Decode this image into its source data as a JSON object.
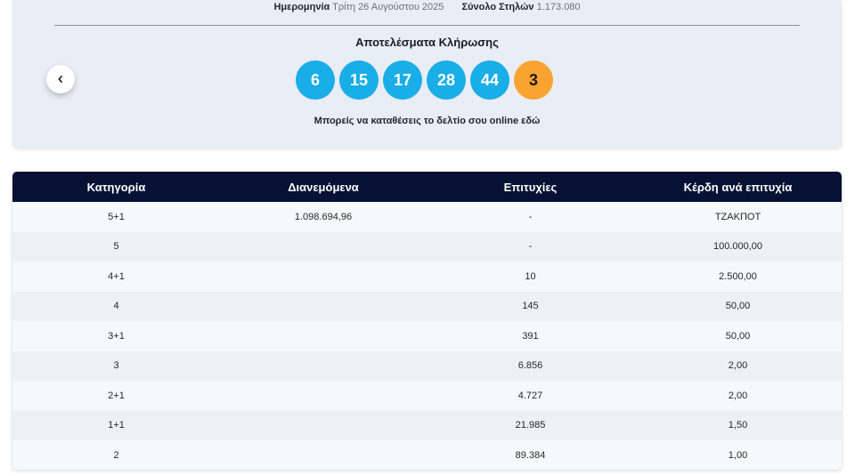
{
  "meta": {
    "date_label": "Ημερομηνία",
    "date_value": "Τρίτη 26 Αυγούστου 2025",
    "total_label": "Σύνολο Στηλών",
    "total_value": "1.173.080"
  },
  "draw": {
    "title": "Αποτελέσματα Κλήρωσης",
    "numbers": [
      "6",
      "15",
      "17",
      "28",
      "44"
    ],
    "bonus": "3",
    "online_text": "Μπορείς να καταθέσεις το δελτίο σου online εδώ"
  },
  "nav": {
    "back_icon": "chevron-left-icon"
  },
  "colors": {
    "ball": "#19aee8",
    "bonus_ball": "#f9a431",
    "table_header": "#061133",
    "panel": "#e9edf5"
  },
  "table": {
    "headers": [
      "Κατηγορία",
      "Διανεμόμενα",
      "Επιτυχίες",
      "Κέρδη ανά επιτυχία"
    ],
    "rows": [
      {
        "category": "5+1",
        "distributed": "1.098.694,96",
        "winners": "-",
        "prize": "ΤΖΑΚΠΟΤ"
      },
      {
        "category": "5",
        "distributed": "",
        "winners": "-",
        "prize": "100.000,00"
      },
      {
        "category": "4+1",
        "distributed": "",
        "winners": "10",
        "prize": "2.500,00"
      },
      {
        "category": "4",
        "distributed": "",
        "winners": "145",
        "prize": "50,00"
      },
      {
        "category": "3+1",
        "distributed": "",
        "winners": "391",
        "prize": "50,00"
      },
      {
        "category": "3",
        "distributed": "",
        "winners": "6.856",
        "prize": "2,00"
      },
      {
        "category": "2+1",
        "distributed": "",
        "winners": "4.727",
        "prize": "2,00"
      },
      {
        "category": "1+1",
        "distributed": "",
        "winners": "21.985",
        "prize": "1,50"
      },
      {
        "category": "2",
        "distributed": "",
        "winners": "89.384",
        "prize": "1,00"
      }
    ]
  }
}
